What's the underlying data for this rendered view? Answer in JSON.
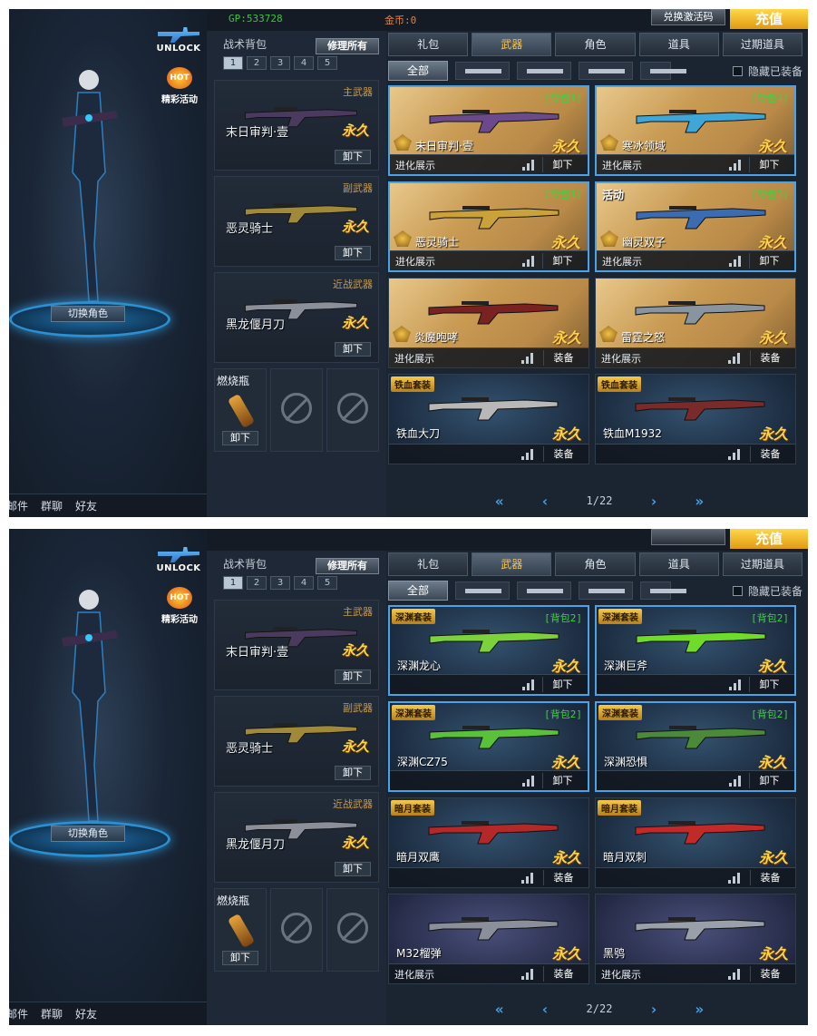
{
  "panels": [
    {
      "top_bar": {
        "gp": "GP:533728",
        "coin": "金币:0",
        "redeem_label": "兑换激活码",
        "recharge_label": "充值"
      },
      "left": {
        "unlock_label": "UNLOCK",
        "hot_badge": "HOT",
        "hot_label": "精彩活动",
        "switch_role": "切换角色",
        "social": {
          "mail": "邮件",
          "group_chat": "群聊",
          "friends": "好友"
        }
      },
      "backpack": {
        "title": "战术背包",
        "repair_all": "修理所有",
        "pages": [
          "1",
          "2",
          "3",
          "4",
          "5"
        ],
        "slots": [
          {
            "category": "主武器",
            "name": "末日审判·壹",
            "status": "永久",
            "action": "卸下"
          },
          {
            "category": "副武器",
            "name": "恶灵骑士",
            "status": "永久",
            "action": "卸下"
          },
          {
            "category": "近战武器",
            "name": "黑龙偃月刀",
            "status": "永久",
            "action": "卸下"
          }
        ],
        "throwable": {
          "name": "燃烧瓶",
          "action": "卸下"
        }
      },
      "tabs": [
        "礼包",
        "武器",
        "角色",
        "道具",
        "过期道具"
      ],
      "active_tab": 1,
      "filters": {
        "all": "全部",
        "hide_equipped": "隐藏已装备"
      },
      "items": [
        {
          "style": "sand",
          "selected": true,
          "pack": "[背包1]",
          "set": "",
          "event": "",
          "name": "末日审判·壹",
          "status": "永久",
          "evolve": "进化展示",
          "action": "卸下",
          "accent": "#6a4a8a"
        },
        {
          "style": "sand",
          "selected": true,
          "pack": "[背包4]",
          "set": "",
          "event": "",
          "name": "寒冰领域",
          "status": "永久",
          "evolve": "进化展示",
          "action": "卸下",
          "accent": "#3fa6d8"
        },
        {
          "style": "sand",
          "selected": true,
          "pack": "[背包1]",
          "set": "",
          "event": "",
          "name": "恶灵骑士",
          "status": "永久",
          "evolve": "进化展示",
          "action": "卸下",
          "accent": "#c9a23a"
        },
        {
          "style": "sand",
          "selected": true,
          "pack": "[背包3]",
          "set": "",
          "event": "活动",
          "name": "幽灵双子",
          "status": "永久",
          "evolve": "进化展示",
          "action": "卸下",
          "accent": "#3b6bb0"
        },
        {
          "style": "sand",
          "selected": false,
          "pack": "",
          "set": "",
          "event": "",
          "name": "炎魔咆哮",
          "status": "永久",
          "evolve": "进化展示",
          "action": "装备",
          "accent": "#7a2222"
        },
        {
          "style": "sand",
          "selected": false,
          "pack": "",
          "set": "",
          "event": "",
          "name": "雷霆之怒",
          "status": "永久",
          "evolve": "进化展示",
          "action": "装备",
          "accent": "#8894a0"
        },
        {
          "style": "blue",
          "selected": false,
          "pack": "",
          "set": "铁血套装",
          "event": "",
          "name": "铁血大刀",
          "status": "永久",
          "evolve": "",
          "action": "装备",
          "accent": "#b8b8b8"
        },
        {
          "style": "blue",
          "selected": false,
          "pack": "",
          "set": "铁血套装",
          "event": "",
          "name": "铁血M1932",
          "status": "永久",
          "evolve": "",
          "action": "装备",
          "accent": "#7a2a2a"
        }
      ],
      "pager": {
        "first": "«",
        "prev": "‹",
        "label": "1/22",
        "next": "›",
        "last": "»"
      }
    },
    {
      "top_bar": {
        "gp": "",
        "coin": "",
        "redeem_label": "",
        "recharge_label": "充值"
      },
      "left": {
        "unlock_label": "UNLOCK",
        "hot_badge": "HOT",
        "hot_label": "精彩活动",
        "switch_role": "切换角色",
        "social": {
          "mail": "邮件",
          "group_chat": "群聊",
          "friends": "好友"
        }
      },
      "backpack": {
        "title": "战术背包",
        "repair_all": "修理所有",
        "pages": [
          "1",
          "2",
          "3",
          "4",
          "5"
        ],
        "slots": [
          {
            "category": "主武器",
            "name": "末日审判·壹",
            "status": "永久",
            "action": "卸下"
          },
          {
            "category": "副武器",
            "name": "恶灵骑士",
            "status": "永久",
            "action": "卸下"
          },
          {
            "category": "近战武器",
            "name": "黑龙偃月刀",
            "status": "永久",
            "action": "卸下"
          }
        ],
        "throwable": {
          "name": "燃烧瓶",
          "action": "卸下"
        }
      },
      "tabs": [
        "礼包",
        "武器",
        "角色",
        "道具",
        "过期道具"
      ],
      "active_tab": 1,
      "filters": {
        "all": "全部",
        "hide_equipped": "隐藏已装备"
      },
      "items": [
        {
          "style": "blue",
          "selected": true,
          "pack": "[背包2]",
          "set": "深渊套装",
          "event": "",
          "name": "深渊龙心",
          "status": "永久",
          "evolve": "",
          "action": "卸下",
          "accent": "#7bd23a"
        },
        {
          "style": "blue",
          "selected": true,
          "pack": "[背包2]",
          "set": "深渊套装",
          "event": "",
          "name": "深渊巨斧",
          "status": "永久",
          "evolve": "",
          "action": "卸下",
          "accent": "#6fdb2a"
        },
        {
          "style": "blue",
          "selected": true,
          "pack": "[背包2]",
          "set": "深渊套装",
          "event": "",
          "name": "深渊CZ75",
          "status": "永久",
          "evolve": "",
          "action": "卸下",
          "accent": "#5ac23a"
        },
        {
          "style": "blue",
          "selected": true,
          "pack": "[背包2]",
          "set": "深渊套装",
          "event": "",
          "name": "深渊恐惧",
          "status": "永久",
          "evolve": "",
          "action": "卸下",
          "accent": "#4a8a3a"
        },
        {
          "style": "blue",
          "selected": false,
          "pack": "",
          "set": "暗月套装",
          "event": "",
          "name": "暗月双鹰",
          "status": "永久",
          "evolve": "",
          "action": "装备",
          "accent": "#b32828"
        },
        {
          "style": "blue",
          "selected": false,
          "pack": "",
          "set": "暗月套装",
          "event": "",
          "name": "暗月双刺",
          "status": "永久",
          "evolve": "",
          "action": "装备",
          "accent": "#c22a2a"
        },
        {
          "style": "purple",
          "selected": false,
          "pack": "",
          "set": "",
          "event": "",
          "name": "M32榴弹",
          "status": "永久",
          "evolve": "进化展示",
          "action": "装备",
          "accent": "#8a8f9a"
        },
        {
          "style": "purple",
          "selected": false,
          "pack": "",
          "set": "",
          "event": "",
          "name": "黑鸮",
          "status": "永久",
          "evolve": "进化展示",
          "action": "装备",
          "accent": "#9aa0aa"
        }
      ],
      "pager": {
        "first": "«",
        "prev": "‹",
        "label": "2/22",
        "next": "›",
        "last": "»"
      }
    }
  ]
}
